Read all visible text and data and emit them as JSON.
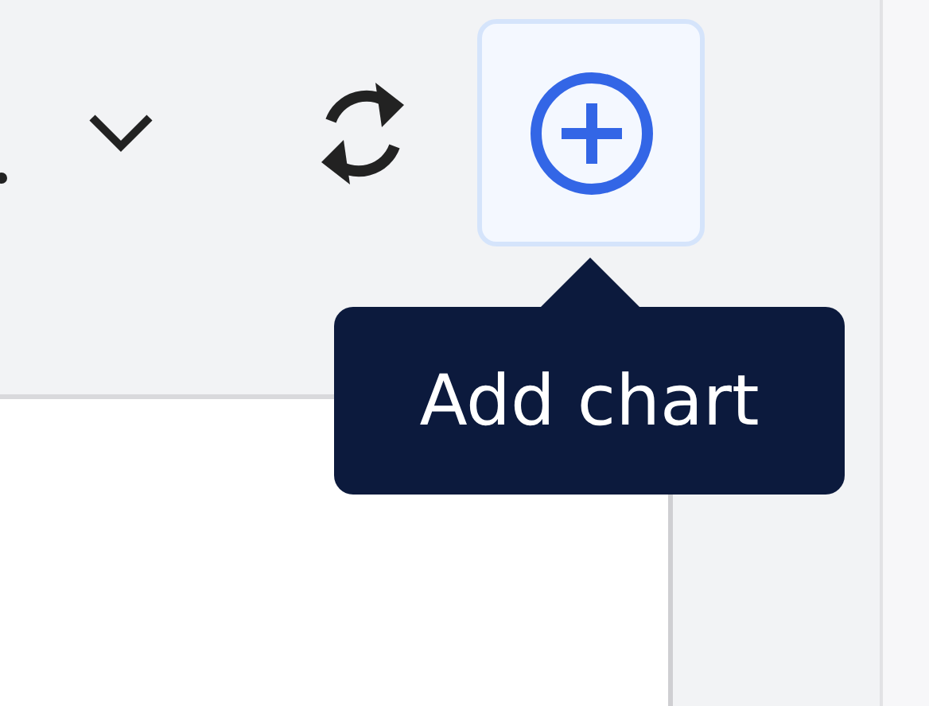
{
  "toolbar": {
    "buttons": [
      {
        "kind": "dropdown",
        "selected": false
      },
      {
        "kind": "refresh",
        "selected": false
      },
      {
        "kind": "add",
        "selected": true
      }
    ]
  },
  "tooltip": {
    "text": "Add chart"
  }
}
